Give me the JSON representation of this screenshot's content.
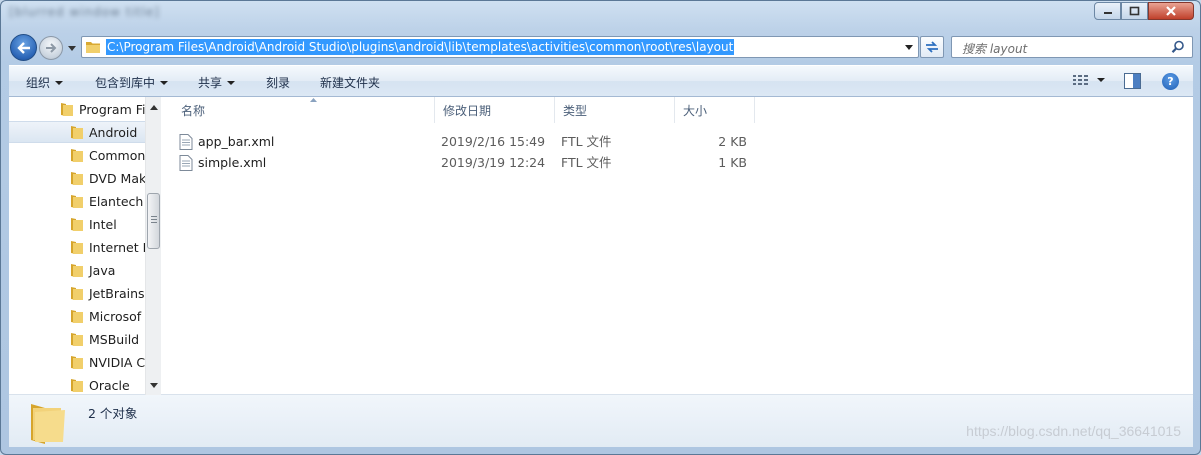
{
  "window": {
    "title": "[blurred window title]"
  },
  "address": {
    "path": "C:\\Program Files\\Android\\Android Studio\\plugins\\android\\lib\\templates\\activities\\common\\root\\res\\layout"
  },
  "search": {
    "placeholder": "搜索 layout"
  },
  "toolbar": {
    "organize": "组织",
    "include_in_library": "包含到库中",
    "share": "共享",
    "burn": "刻录",
    "new_folder": "新建文件夹"
  },
  "tree": {
    "items": [
      {
        "label": "Program Fi"
      },
      {
        "label": "Android"
      },
      {
        "label": "Common"
      },
      {
        "label": "DVD Mak"
      },
      {
        "label": "Elantech"
      },
      {
        "label": "Intel"
      },
      {
        "label": "Internet E"
      },
      {
        "label": "Java"
      },
      {
        "label": "JetBrains"
      },
      {
        "label": "Microsof"
      },
      {
        "label": "MSBuild"
      },
      {
        "label": "NVIDIA C"
      },
      {
        "label": "Oracle"
      }
    ]
  },
  "columns": {
    "name": "名称",
    "modified": "修改日期",
    "type": "类型",
    "size": "大小"
  },
  "files": [
    {
      "name": "app_bar.xml",
      "modified": "2019/2/16 15:49",
      "type": "FTL 文件",
      "size": "2 KB"
    },
    {
      "name": "simple.xml",
      "modified": "2019/3/19 12:24",
      "type": "FTL 文件",
      "size": "1 KB"
    }
  ],
  "status": {
    "count": "2 个对象"
  },
  "watermark": "https://blog.csdn.net/qq_36641015",
  "colors": {
    "selection": "#3399ff",
    "frame": "#b3cbe5",
    "folder": "#e8c15a"
  }
}
